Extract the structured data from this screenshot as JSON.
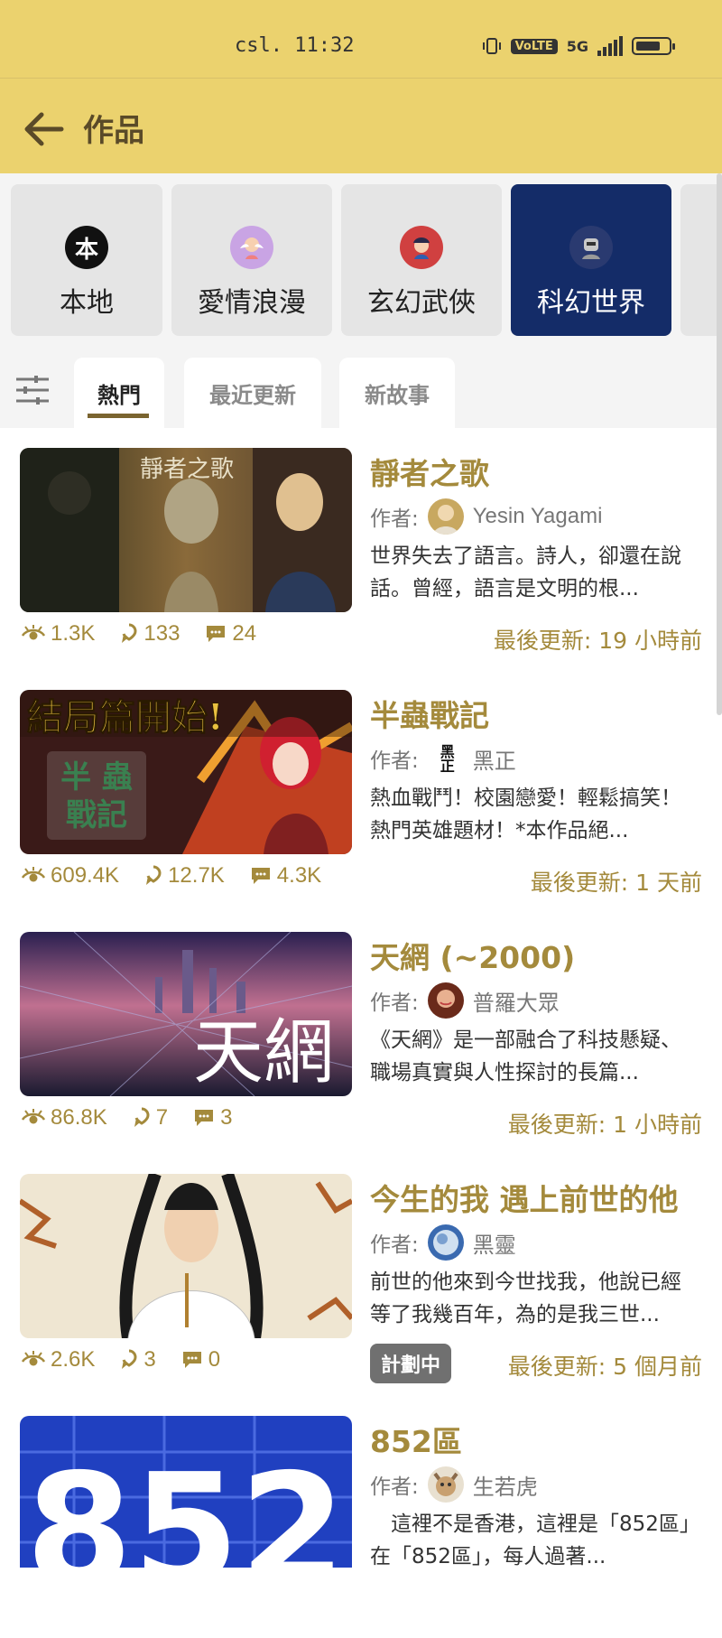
{
  "status_bar": {
    "time": "csl. 11:32",
    "network": "5G",
    "volte": "VoLTE"
  },
  "header": {
    "title": "作品"
  },
  "categories": [
    {
      "label": "本地",
      "icon": "本",
      "active": false
    },
    {
      "label": "愛情浪漫",
      "icon": "cupid-icon",
      "active": false
    },
    {
      "label": "玄幻武俠",
      "icon": "warrior-icon",
      "active": false
    },
    {
      "label": "科幻世界",
      "icon": "robot-icon",
      "active": true
    }
  ],
  "tabs": [
    {
      "label": "熱門",
      "active": true
    },
    {
      "label": "最近更新",
      "active": false
    },
    {
      "label": "新故事",
      "active": false
    }
  ],
  "author_prefix": "作者:",
  "stories": [
    {
      "title": "靜者之歌",
      "cover_text": "靜者之歌",
      "author": "Yesin Yagami",
      "description": "世界失去了語言。詩人，卻還在說話。曾經，語言是文明的根...",
      "views": "1.3K",
      "likes": "133",
      "comments": "24",
      "updated": "最後更新: 19 小時前"
    },
    {
      "title": "半蟲戰記",
      "cover_text": "結局篇開始!",
      "author_badge": "黑正",
      "author": "黑正",
      "description": "熱血戰鬥！校園戀愛！輕鬆搞笑！熱門英雄題材！*本作品絕...",
      "views": "609.4K",
      "likes": "12.7K",
      "comments": "4.3K",
      "updated": "最後更新: 1 天前"
    },
    {
      "title": "天網 (~2000)",
      "cover_text": "天網",
      "author": "普羅大眾",
      "description": "《天網》是一部融合了科技懸疑、職場真實與人性探討的長篇...",
      "views": "86.8K",
      "likes": "7",
      "comments": "3",
      "updated": "最後更新: 1 小時前"
    },
    {
      "title": "今生的我 遇上前世的他",
      "author": "黑靈",
      "description": "前世的他來到今世找我，他說已經等了我幾百年，為的是我三世...",
      "views": "2.6K",
      "likes": "3",
      "comments": "0",
      "badge": "計劃中",
      "updated": "最後更新: 5 個月前"
    },
    {
      "title": "852區",
      "cover_text": "852",
      "author": "生若虎",
      "description": "　這裡不是香港，這裡是「852區」　在「852區」，每人過著..."
    }
  ],
  "colors": {
    "header_bg": "#ebd26e",
    "accent_text": "#a48a3c",
    "active_category": "#142c68"
  }
}
